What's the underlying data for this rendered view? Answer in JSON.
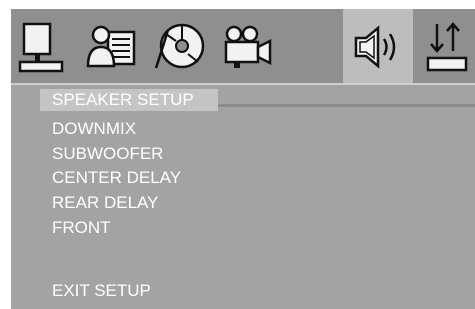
{
  "tabs": [
    {
      "icon": "computer-monitor-icon",
      "active": false
    },
    {
      "icon": "person-document-icon",
      "active": false
    },
    {
      "icon": "disc-icon",
      "active": false
    },
    {
      "icon": "video-camera-icon",
      "active": false
    },
    {
      "icon": "speaker-icon",
      "active": true
    },
    {
      "icon": "sort-arrows-icon",
      "active": false
    }
  ],
  "menu": {
    "title": "SPEAKER SETUP",
    "items": [
      "DOWNMIX",
      "SUBWOOFER",
      "CENTER DELAY",
      "REAR DELAY",
      "FRONT"
    ],
    "exit": "EXIT SETUP"
  },
  "colors": {
    "panel": "#8f8f8f",
    "menu_bg": "#a3a3a3",
    "highlight": "#c4c4c4",
    "text": "#ffffff",
    "icon": "#1a1a1a"
  }
}
